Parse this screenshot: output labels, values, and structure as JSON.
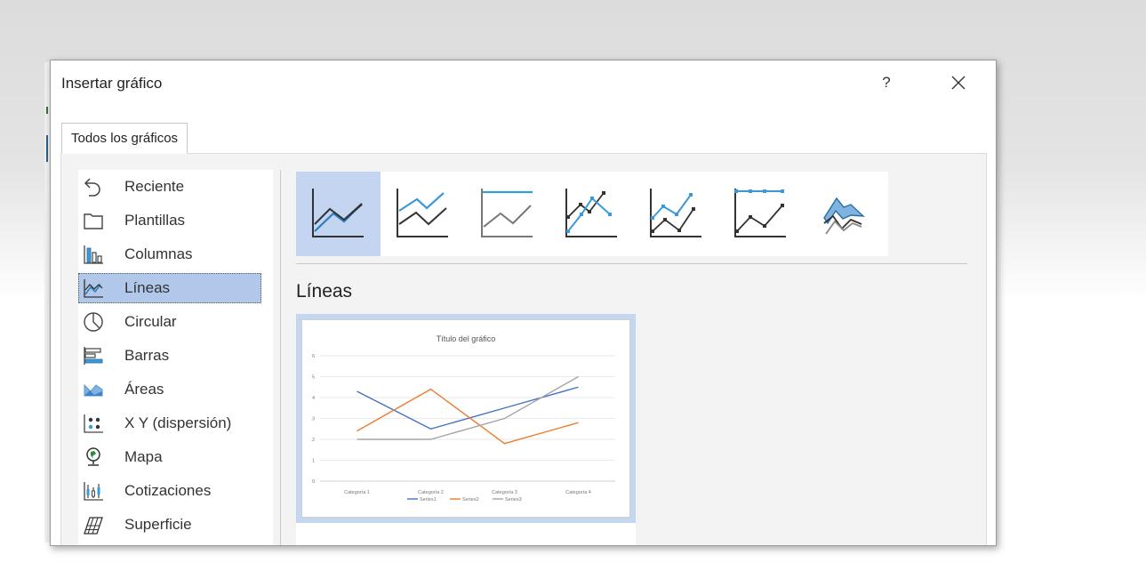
{
  "dialog": {
    "title": "Insertar gráfico",
    "help_label": "?",
    "tab_label": "Todos los gráficos"
  },
  "sidebar": {
    "items": [
      {
        "label": "Reciente",
        "icon": "recent-icon"
      },
      {
        "label": "Plantillas",
        "icon": "templates-folder-icon"
      },
      {
        "label": "Columnas",
        "icon": "column-chart-icon"
      },
      {
        "label": "Líneas",
        "icon": "line-chart-icon",
        "selected": true
      },
      {
        "label": "Circular",
        "icon": "pie-chart-icon"
      },
      {
        "label": "Barras",
        "icon": "bar-chart-icon"
      },
      {
        "label": "Áreas",
        "icon": "area-chart-icon"
      },
      {
        "label": "X Y (dispersión)",
        "icon": "scatter-chart-icon"
      },
      {
        "label": "Mapa",
        "icon": "map-chart-icon"
      },
      {
        "label": "Cotizaciones",
        "icon": "stock-chart-icon"
      },
      {
        "label": "Superficie",
        "icon": "surface-chart-icon"
      }
    ]
  },
  "subtypes": [
    {
      "name": "line",
      "selected": true
    },
    {
      "name": "stacked-line"
    },
    {
      "name": "100-stacked-line"
    },
    {
      "name": "line-with-markers"
    },
    {
      "name": "stacked-line-with-markers"
    },
    {
      "name": "100-stacked-line-with-markers"
    },
    {
      "name": "3d-line"
    }
  ],
  "section_heading": "Líneas",
  "colors": {
    "accent": "#3a9ad9",
    "selection": "#b2c8ea",
    "series1": "#4472c4",
    "series2": "#ed7d31",
    "series3": "#a5a5a5"
  },
  "chart_data": {
    "type": "line",
    "title": "Título del gráfico",
    "categories": [
      "Categoría 1",
      "Categoría 2",
      "Categoría 3",
      "Categoría 4"
    ],
    "series": [
      {
        "name": "Series1",
        "values": [
          4.3,
          2.5,
          3.5,
          4.5
        ]
      },
      {
        "name": "Series2",
        "values": [
          2.4,
          4.4,
          1.8,
          2.8
        ]
      },
      {
        "name": "Series3",
        "values": [
          2,
          2,
          3,
          5
        ]
      }
    ],
    "yticks": [
      "0",
      "1",
      "2",
      "3",
      "4",
      "5",
      "6"
    ],
    "ylim": [
      0,
      6
    ],
    "grid": true,
    "legend": "bottom"
  }
}
